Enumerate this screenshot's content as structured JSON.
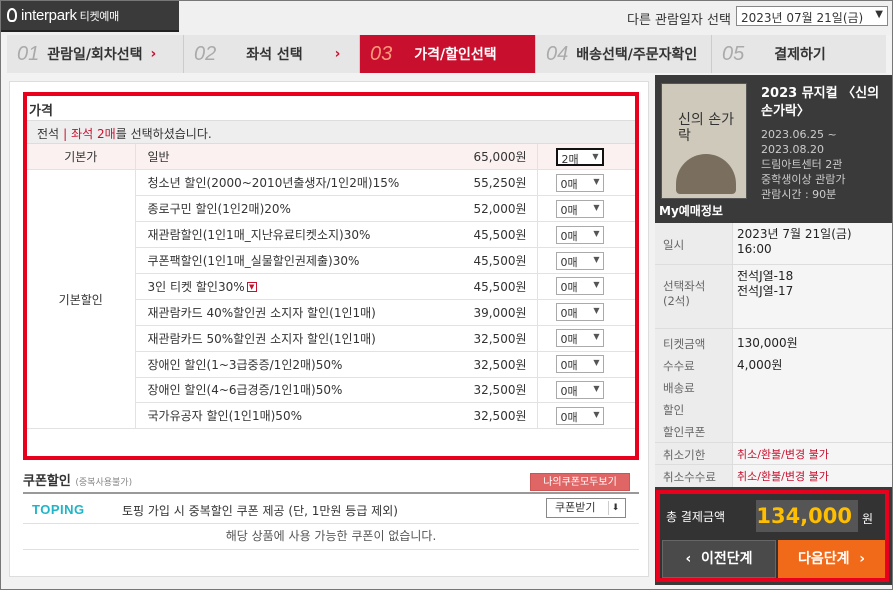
{
  "header": {
    "logo_text": "interpark",
    "logo_sub": "티켓예매",
    "date_label": "다른 관람일자 선택",
    "date_value": "2023년 07월 21일(금)"
  },
  "steps": [
    {
      "num": "01",
      "label": "관람일/회차선택"
    },
    {
      "num": "02",
      "label": "좌석 선택"
    },
    {
      "num": "03",
      "label": "가격/할인선택"
    },
    {
      "num": "04",
      "label": "배송선택/주문자확인"
    },
    {
      "num": "05",
      "label": "결제하기"
    }
  ],
  "price": {
    "title": "가격",
    "seat_grade": "전석",
    "seat_sep": "|",
    "seat_count": "좌석 2매",
    "seat_suffix": "를 선택하셨습니다.",
    "base_label": "기본가",
    "discount_label": "기본할인",
    "rows": [
      {
        "name": "일반",
        "amount": "65,000원",
        "qty": "2매"
      },
      {
        "name": "청소년 할인(2000~2010년출생자/1인2매)15%",
        "amount": "55,250원",
        "qty": "0매"
      },
      {
        "name": "종로구민 할인(1인2매)20%",
        "amount": "52,000원",
        "qty": "0매"
      },
      {
        "name": "재관람할인(1인1매_지난유료티켓소지)30%",
        "amount": "45,500원",
        "qty": "0매"
      },
      {
        "name": "쿠폰팩할인(1인1매_실물할인권제출)30%",
        "amount": "45,500원",
        "qty": "0매"
      },
      {
        "name": "3인 티켓 할인30%",
        "amount": "45,500원",
        "qty": "0매"
      },
      {
        "name": "재관람카드 40%할인권 소지자 할인(1인1매)",
        "amount": "39,000원",
        "qty": "0매"
      },
      {
        "name": "재관람카드 50%할인권 소지자 할인(1인1매)",
        "amount": "32,500원",
        "qty": "0매"
      },
      {
        "name": "장애인 할인(1~3급중증/1인2매)50%",
        "amount": "32,500원",
        "qty": "0매"
      },
      {
        "name": "장애인 할인(4~6급경증/1인1매)50%",
        "amount": "32,500원",
        "qty": "0매"
      },
      {
        "name": "국가유공자 할인(1인1매)50%",
        "amount": "32,500원",
        "qty": "0매"
      }
    ]
  },
  "coupon": {
    "title": "쿠폰할인",
    "note": "(중복사용불가)",
    "my_coupons": "나의쿠폰모두보기",
    "brand": "TOPING",
    "desc": "토핑 가입 시 중복할인 쿠폰 제공 (단, 1만원 등급 제외)",
    "get_label": "쿠폰받기",
    "empty": "해당 상품에 사용 가능한 쿠폰이 없습니다."
  },
  "show": {
    "poster_title": "신의 손가락",
    "title": "2023 뮤지컬 〈신의 손가락〉",
    "info": [
      "2023.06.25 ~",
      "2023.08.20",
      "드림아트센터 2관",
      "중학생이상 관람가",
      "관람시간 : 90분"
    ]
  },
  "my": {
    "title": "My예매정보",
    "date_label": "일시",
    "date_value": "2023년 7월 21일(금)",
    "time_value": "16:00",
    "seat_label": "선택좌석",
    "seat_count": "(2석)",
    "seat_1": "전석J열-18",
    "seat_2": "전석J열-17",
    "ticket_label": "티켓금액",
    "ticket_value": "130,000원",
    "fee_label": "수수료",
    "fee_value": "4,000원",
    "delivery_label": "배송료",
    "discount_label": "할인",
    "coupon_label": "할인쿠폰",
    "cancel_deadline_label": "취소기한",
    "cancel_deadline_value": "취소/환불/변경 불가",
    "cancel_fee_label": "취소수수료",
    "cancel_fee_value": "취소/환불/변경 불가"
  },
  "total": {
    "label": "총 결제금액",
    "amount": "134,000",
    "unit": "원",
    "prev": "이전단계",
    "next": "다음단계"
  }
}
